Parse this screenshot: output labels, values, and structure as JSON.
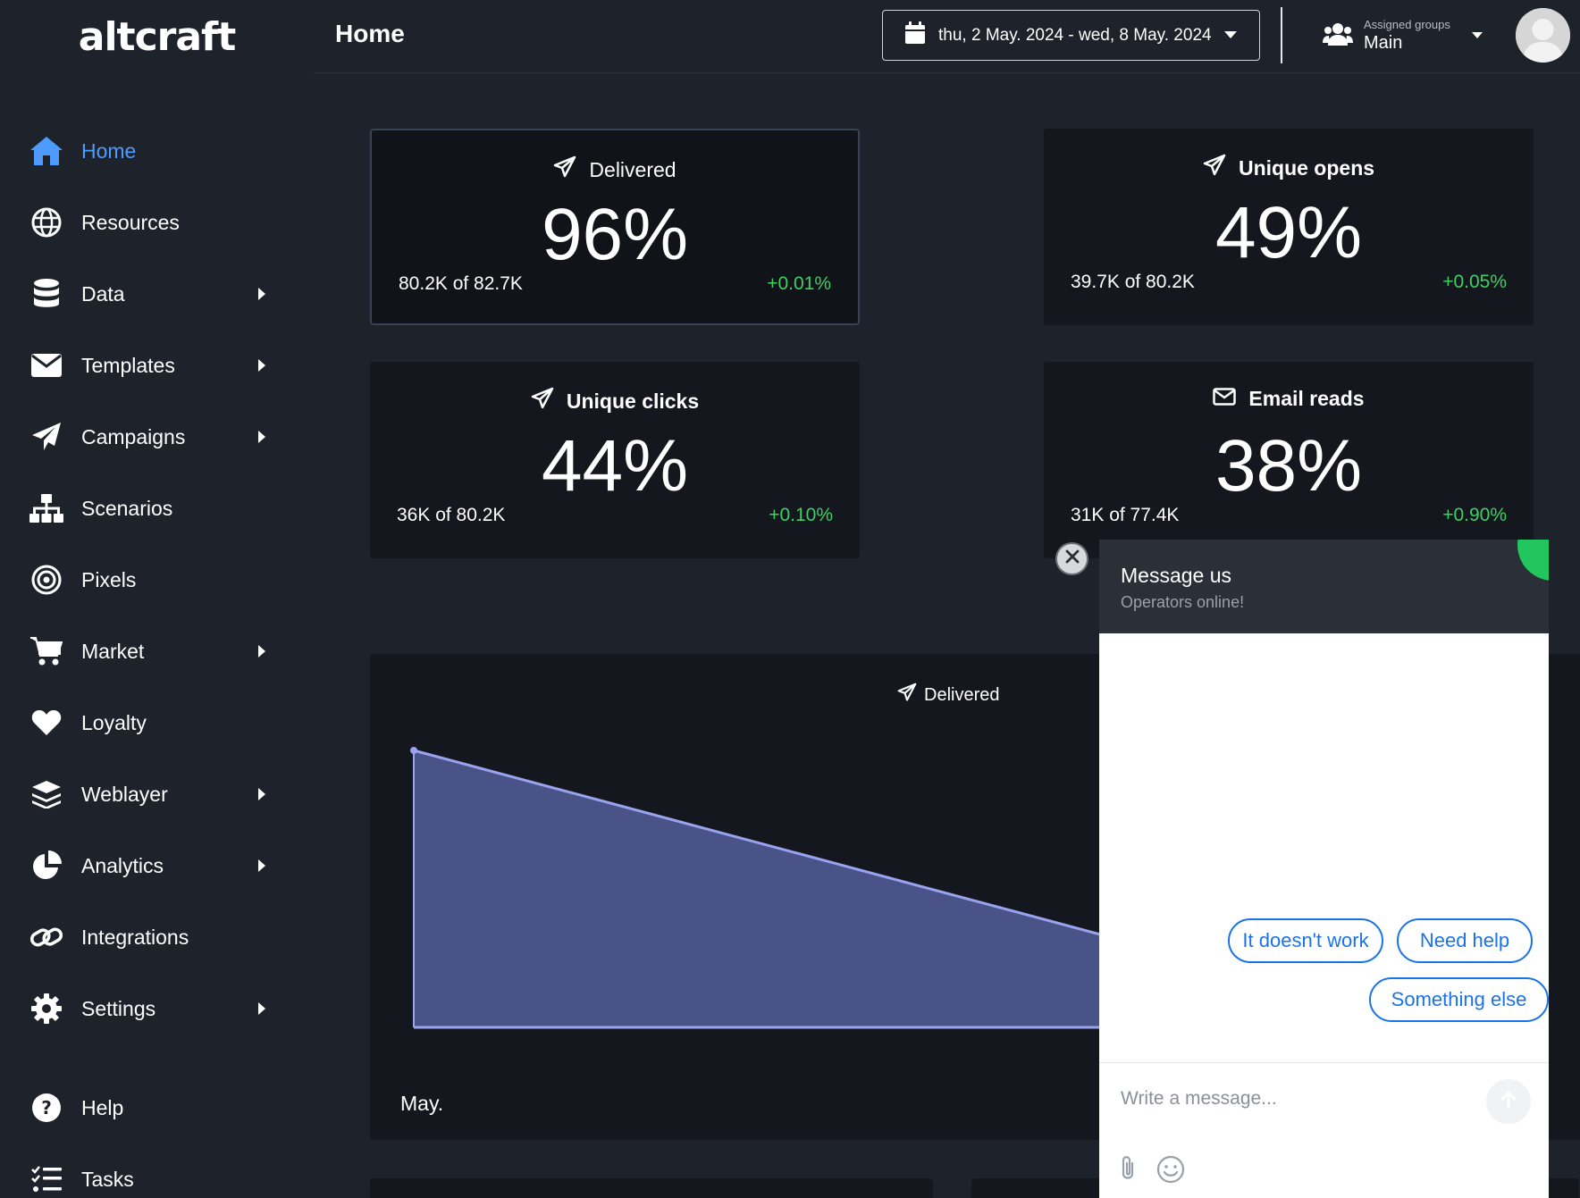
{
  "app": {
    "logo": "altcraft"
  },
  "header": {
    "title": "Home",
    "date_range": "thu, 2 May. 2024 - wed, 8 May. 2024",
    "groups_caption": "Assigned groups",
    "groups_value": "Main"
  },
  "sidebar": {
    "items": [
      {
        "label": "Home",
        "icon": "home-icon",
        "active": true,
        "submenu": false
      },
      {
        "label": "Resources",
        "icon": "globe-icon",
        "submenu": false
      },
      {
        "label": "Data",
        "icon": "database-icon",
        "submenu": true
      },
      {
        "label": "Templates",
        "icon": "envelope-icon",
        "submenu": true
      },
      {
        "label": "Campaigns",
        "icon": "paper-plane-icon",
        "submenu": true
      },
      {
        "label": "Scenarios",
        "icon": "sitemap-icon",
        "submenu": false
      },
      {
        "label": "Pixels",
        "icon": "target-icon",
        "submenu": false
      },
      {
        "label": "Market",
        "icon": "cart-icon",
        "submenu": true
      },
      {
        "label": "Loyalty",
        "icon": "heart-icon",
        "submenu": false
      },
      {
        "label": "Weblayer",
        "icon": "layers-icon",
        "submenu": true
      },
      {
        "label": "Analytics",
        "icon": "pie-chart-icon",
        "submenu": true
      },
      {
        "label": "Integrations",
        "icon": "link-icon",
        "submenu": false
      },
      {
        "label": "Settings",
        "icon": "gear-icon",
        "submenu": true
      },
      {
        "label": "Help",
        "icon": "question-circle-icon",
        "submenu": false
      },
      {
        "label": "Tasks",
        "icon": "tasks-icon",
        "submenu": false
      }
    ]
  },
  "stats": [
    {
      "title": "Delivered",
      "icon": "paper-plane-icon",
      "value": "96%",
      "count": "80.2K of 82.7K",
      "delta": "+0.01%"
    },
    {
      "title": "Unique opens",
      "icon": "paper-plane-icon",
      "value": "49%",
      "count": "39.7K of 80.2K",
      "delta": "+0.05%"
    },
    {
      "title": "Unique clicks",
      "icon": "paper-plane-icon",
      "value": "44%",
      "count": "36K of 80.2K",
      "delta": "+0.10%"
    },
    {
      "title": "Email reads",
      "icon": "envelope-icon",
      "value": "38%",
      "count": "31K of 77.4K",
      "delta": "+0.90%"
    }
  ],
  "delivered_chart": {
    "title": "Delivered",
    "x_label": "May."
  },
  "chat": {
    "title": "Message us",
    "subtitle": "Operators online!",
    "status_color": "#22c55e",
    "quick_replies": [
      "It doesn't work",
      "Need help",
      "Something else"
    ],
    "input_placeholder": "Write a message..."
  },
  "colors": {
    "accent": "#4d9bff",
    "positive": "#3fd065",
    "chart_fill": "#4a5388",
    "chart_line": "#9aa3f0"
  }
}
